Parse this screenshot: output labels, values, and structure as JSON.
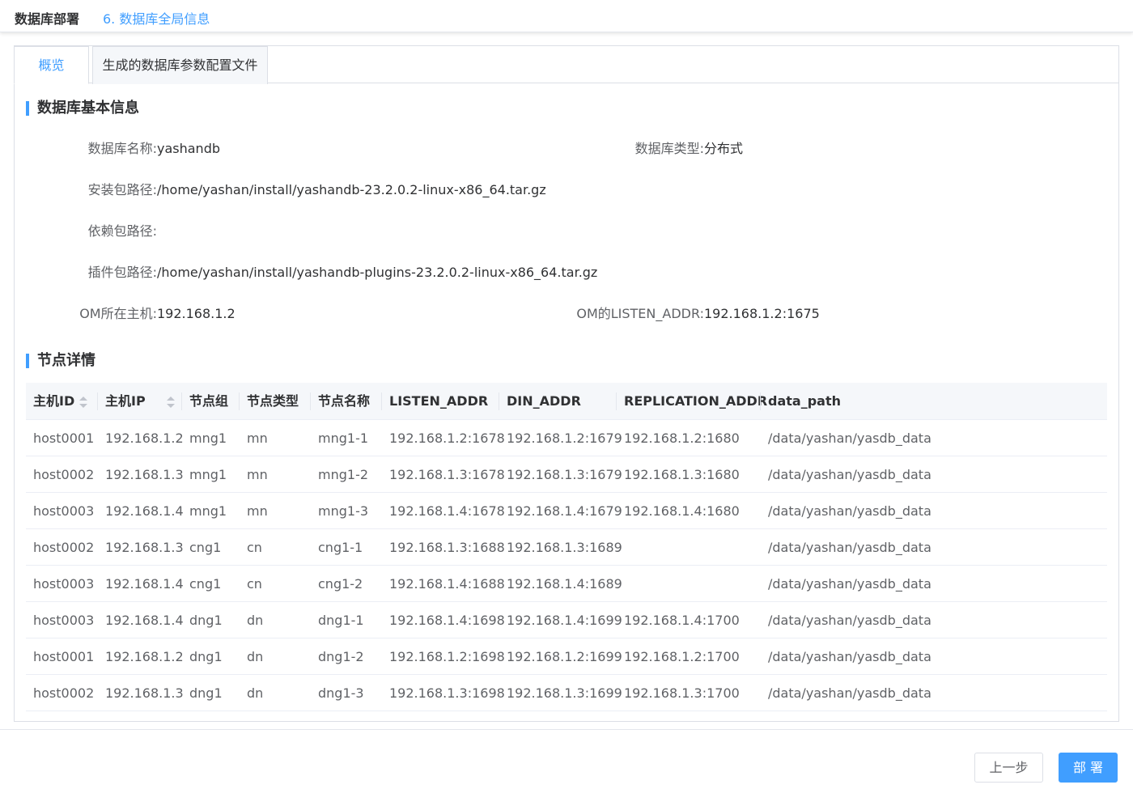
{
  "breadcrumb": {
    "title": "数据库部署",
    "step": "6. 数据库全局信息"
  },
  "tabs": [
    {
      "label": "概览"
    },
    {
      "label": "生成的数据库参数配置文件"
    }
  ],
  "basic": {
    "title": "数据库基本信息",
    "db_name_label": "数据库名称:",
    "db_name": "yashandb",
    "db_type_label": "数据库类型:",
    "db_type": "分布式",
    "install_label": "安装包路径:",
    "install_path": "/home/yashan/install/yashandb-23.2.0.2-linux-x86_64.tar.gz",
    "depend_label": "依赖包路径:",
    "depend_path": "",
    "plugin_label": "插件包路径:",
    "plugin_path": "/home/yashan/install/yashandb-plugins-23.2.0.2-linux-x86_64.tar.gz",
    "om_host_label": "OM所在主机:",
    "om_host": "192.168.1.2",
    "om_listen_label": "OM的LISTEN_ADDR:",
    "om_listen": "192.168.1.2:1675"
  },
  "nodes": {
    "title": "节点详情",
    "columns": [
      "主机ID",
      "主机IP",
      "节点组",
      "节点类型",
      "节点名称",
      "LISTEN_ADDR",
      "DIN_ADDR",
      "REPLICATION_ADDR",
      "data_path"
    ],
    "rows": [
      [
        "host0001",
        "192.168.1.2",
        "mng1",
        "mn",
        "mng1-1",
        "192.168.1.2:1678",
        "192.168.1.2:1679",
        "192.168.1.2:1680",
        "/data/yashan/yasdb_data"
      ],
      [
        "host0002",
        "192.168.1.3",
        "mng1",
        "mn",
        "mng1-2",
        "192.168.1.3:1678",
        "192.168.1.3:1679",
        "192.168.1.3:1680",
        "/data/yashan/yasdb_data"
      ],
      [
        "host0003",
        "192.168.1.4",
        "mng1",
        "mn",
        "mng1-3",
        "192.168.1.4:1678",
        "192.168.1.4:1679",
        "192.168.1.4:1680",
        "/data/yashan/yasdb_data"
      ],
      [
        "host0002",
        "192.168.1.3",
        "cng1",
        "cn",
        "cng1-1",
        "192.168.1.3:1688",
        "192.168.1.3:1689",
        "",
        "/data/yashan/yasdb_data"
      ],
      [
        "host0003",
        "192.168.1.4",
        "cng1",
        "cn",
        "cng1-2",
        "192.168.1.4:1688",
        "192.168.1.4:1689",
        "",
        "/data/yashan/yasdb_data"
      ],
      [
        "host0003",
        "192.168.1.4",
        "dng1",
        "dn",
        "dng1-1",
        "192.168.1.4:1698",
        "192.168.1.4:1699",
        "192.168.1.4:1700",
        "/data/yashan/yasdb_data"
      ],
      [
        "host0001",
        "192.168.1.2",
        "dng1",
        "dn",
        "dng1-2",
        "192.168.1.2:1698",
        "192.168.1.2:1699",
        "192.168.1.2:1700",
        "/data/yashan/yasdb_data"
      ],
      [
        "host0002",
        "192.168.1.3",
        "dng1",
        "dn",
        "dng1-3",
        "192.168.1.3:1698",
        "192.168.1.3:1699",
        "192.168.1.3:1700",
        "/data/yashan/yasdb_data"
      ]
    ]
  },
  "footer": {
    "prev_label": "上一步",
    "deploy_label": "部 署"
  }
}
